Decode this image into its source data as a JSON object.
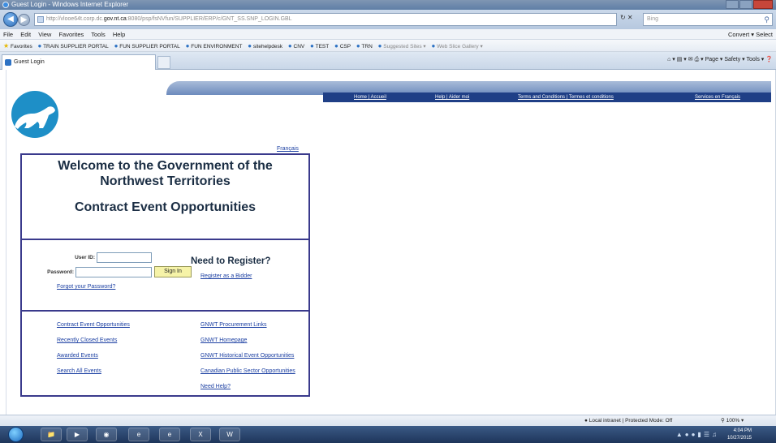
{
  "window": {
    "title": "Guest Login - Windows Internet Explorer"
  },
  "address_bar": {
    "url_prefix": "http://",
    "url_host_start": "vlooe64t.corp.dc.",
    "url_host_main": "gov.nt.ca",
    "url_rest": ":8080/psp/fsNVfun/SUPPLIER/ERP/c/GNT_SS.SNP_LOGIN.GBL",
    "search_placeholder": "Bing"
  },
  "menu": {
    "items": [
      "File",
      "Edit",
      "View",
      "Favorites",
      "Tools",
      "Help"
    ],
    "right": "Convert ▾  Select"
  },
  "favorites_bar": {
    "label": "Favorites",
    "items": [
      "TRAIN SUPPLIER PORTAL",
      "FUN SUPPLIER PORTAL",
      "FUN ENVIRONMENT",
      "sitehelpdesk",
      "CNV",
      "TEST",
      "CSP",
      "TRN",
      "Suggested Sites ▾",
      "Web Slice Gallery ▾"
    ]
  },
  "command_bar": {
    "tab_title": "Guest Login",
    "tools": [
      "Page ▾",
      "Safety ▾",
      "Tools ▾"
    ]
  },
  "nav_links": {
    "home": "Home | Accueil",
    "help": "Help | Aider moi",
    "terms": "Terms and Conditions | Termes et conditions",
    "french": "Services en Français"
  },
  "language_link": "Français",
  "welcome": {
    "line1": "Welcome to the Government of the",
    "line2": "Northwest Territories",
    "subtitle": "Contract Event Opportunities"
  },
  "login": {
    "user_id_label": "User ID:",
    "password_label": "Password:",
    "user_id_value": "",
    "password_value": "",
    "sign_in": "Sign In",
    "forgot": "Forgot your Password?"
  },
  "register": {
    "title": "Need to Register?",
    "link": "Register as a Bidder"
  },
  "links": {
    "left": [
      "Contract Event Opportunities",
      "Recently Closed Events",
      "Awarded Events",
      "Search All Events"
    ],
    "right": [
      "GNWT Procurement Links",
      "GNWT Homepage",
      "GNWT Historical Event Opportunities",
      "Canadian Public Sector Opportunities",
      "Need Help?"
    ]
  },
  "status_bar": {
    "zone": "Local intranet | Protected Mode: Off",
    "zoom": "100%"
  },
  "taskbar": {
    "time": "4:04 PM",
    "date": "10/27/2015"
  },
  "colors": {
    "nav_band": "#1f3f86",
    "box_border": "#3a3a8c",
    "link": "#1b3fa2",
    "heading": "#1b2e44",
    "sign_in_button": "#f6f3a8"
  }
}
